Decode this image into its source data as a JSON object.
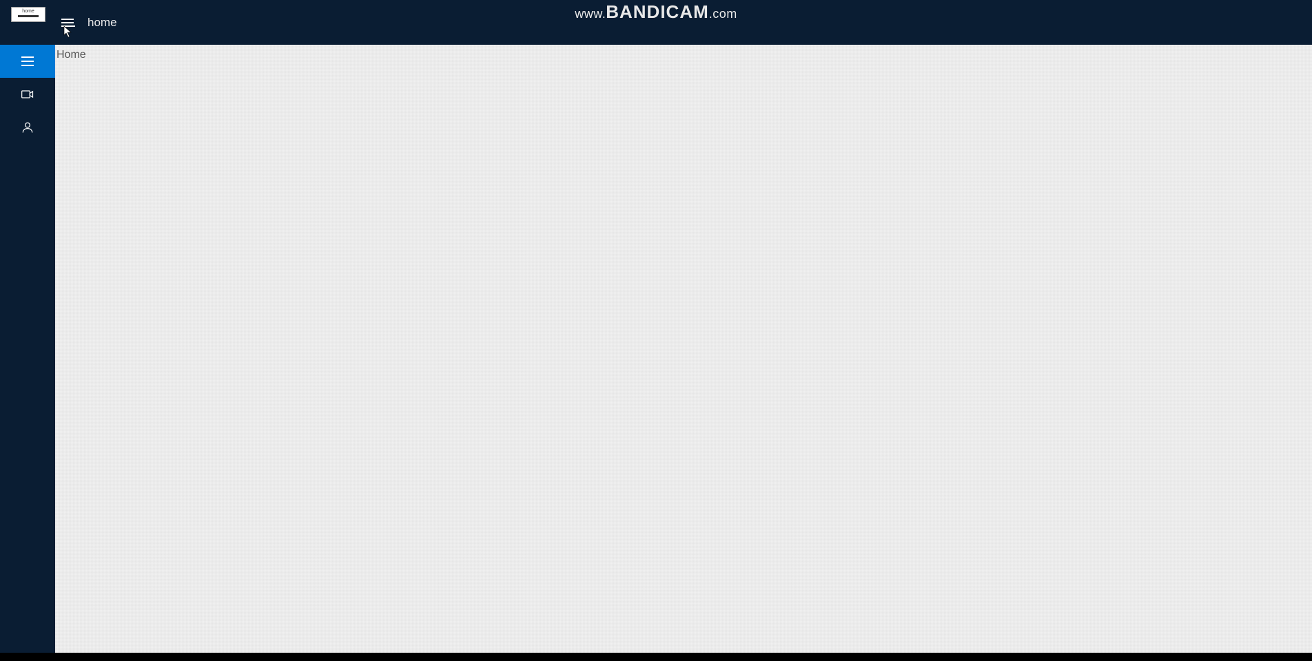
{
  "watermark": {
    "prefix": "www.",
    "main": "BANDICAM",
    "suffix": ".com"
  },
  "header": {
    "thumbnail_label": "home",
    "title": "home"
  },
  "sidebar": {
    "items": [
      {
        "name": "menu",
        "icon": "hamburger",
        "active": true
      },
      {
        "name": "video",
        "icon": "video-camera",
        "active": false
      },
      {
        "name": "user",
        "icon": "person",
        "active": false
      }
    ]
  },
  "content": {
    "heading": "Home"
  }
}
